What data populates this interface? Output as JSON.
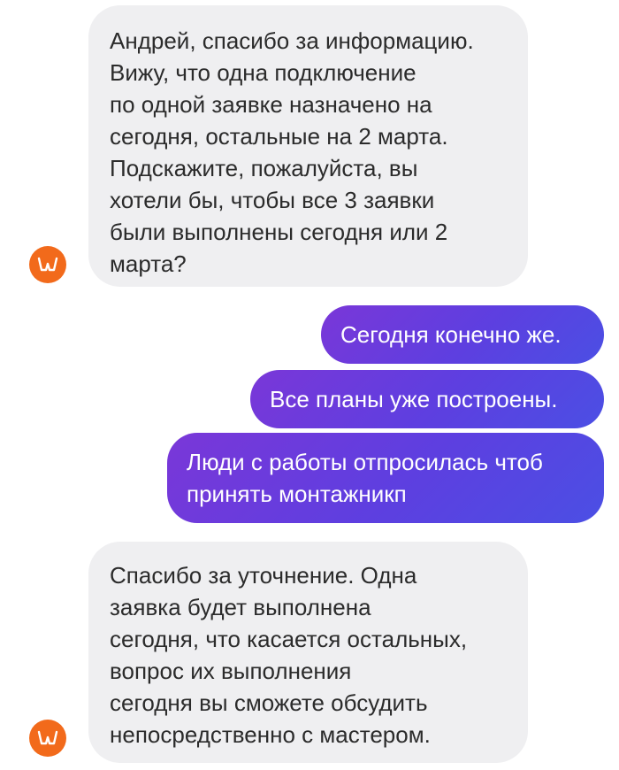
{
  "messages": [
    {
      "direction": "incoming",
      "lines": [
        "Андрей, спасибо за информацию.",
        "Вижу, что одна подключение",
        "по одной заявке назначено на",
        "сегодня, остальные на 2 марта.",
        "Подскажите, пожалуйста, вы",
        "хотели бы, чтобы все 3 заявки",
        "были выполнены сегодня или 2",
        "марта?"
      ]
    },
    {
      "direction": "outgoing",
      "lines": [
        "Сегодня конечно же."
      ]
    },
    {
      "direction": "outgoing",
      "lines": [
        "Все планы уже построены."
      ]
    },
    {
      "direction": "outgoing",
      "lines": [
        "Люди с работы отпросилась чтоб",
        "принять монтажникп"
      ]
    },
    {
      "direction": "incoming",
      "lines": [
        "Спасибо за уточнение. Одна",
        "заявка будет выполнена",
        "сегодня, что касается остальных,",
        "вопрос их выполнения",
        "сегодня вы сможете обсудить",
        "непосредственно с мастером."
      ]
    }
  ],
  "avatar": {
    "icon": "brand-logo-icon",
    "color": "#f26a1b"
  },
  "colors": {
    "incoming_bubble": "#efeff1",
    "outgoing_gradient_start": "#7a37d8",
    "outgoing_gradient_end": "#4b4fe4"
  }
}
